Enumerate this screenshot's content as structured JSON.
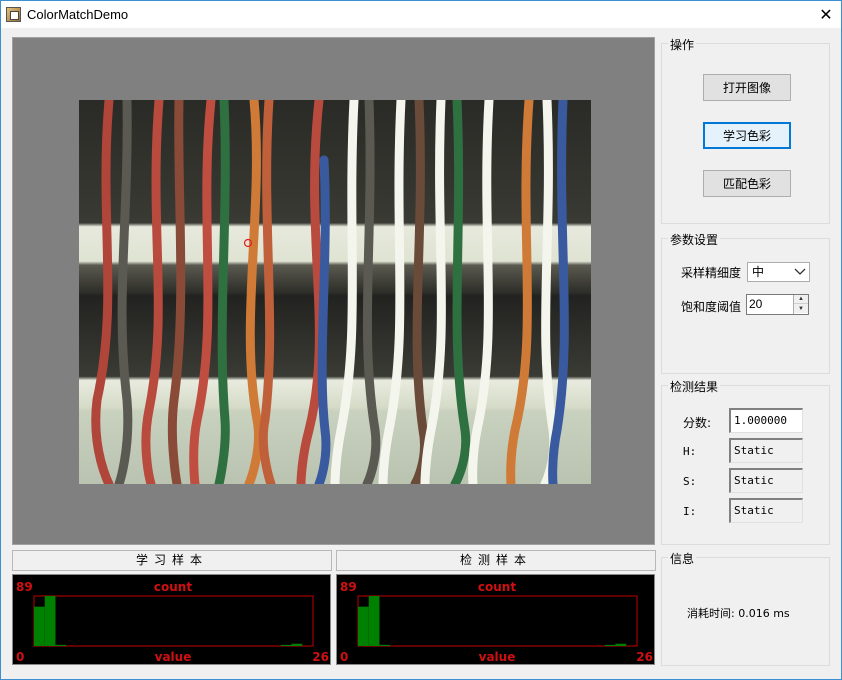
{
  "window": {
    "title": "ColorMatchDemo"
  },
  "ops": {
    "label": "操作",
    "open_label": "打开图像",
    "learn_label": "学习色彩",
    "match_label": "匹配色彩"
  },
  "params": {
    "label": "参数设置",
    "sampling_label": "采样精细度",
    "sampling_value": "中",
    "saturation_label": "饱和度阈值",
    "saturation_value": "20"
  },
  "results": {
    "label": "检测结果",
    "score_label": "分数:",
    "score_value": "1.000000",
    "h_label": "H:",
    "h_value": "Static",
    "s_label": "S:",
    "s_value": "Static",
    "i_label": "I:",
    "i_value": "Static"
  },
  "info": {
    "label": "信息",
    "text": "消耗时间: 0.016 ms"
  },
  "histograms": {
    "ymax_label": "89",
    "ymin_label": "0",
    "xmax_label": "26",
    "count_label": "count",
    "value_label": "value",
    "learn": {
      "title": "学习样本",
      "values": [
        70,
        89,
        2,
        0,
        0,
        0,
        0,
        0,
        0,
        0,
        0,
        0,
        0,
        0,
        0,
        0,
        0,
        0,
        0,
        0,
        0,
        0,
        0,
        2,
        4,
        0
      ]
    },
    "detect": {
      "title": "检测样本",
      "values": [
        70,
        89,
        2,
        0,
        0,
        0,
        0,
        0,
        0,
        0,
        0,
        0,
        0,
        0,
        0,
        0,
        0,
        0,
        0,
        0,
        0,
        0,
        0,
        2,
        4,
        0
      ]
    }
  },
  "colors": {
    "hist_bar": "#008000",
    "hist_frame": "#c00000",
    "hist_text": "#d01010"
  }
}
